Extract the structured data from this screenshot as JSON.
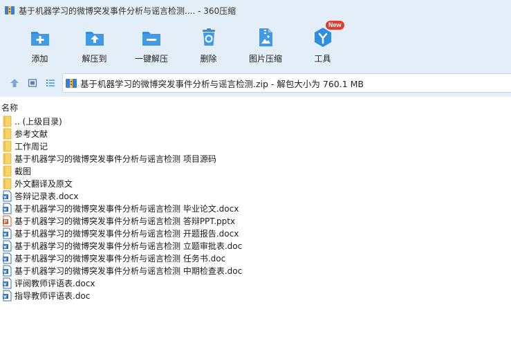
{
  "window": {
    "title": "基于机器学习的微博突发事件分析与谣言检测.... - 360压缩"
  },
  "toolbar": {
    "items": [
      {
        "label": "添加",
        "icon": "add-icon"
      },
      {
        "label": "解压到",
        "icon": "extract-to-icon"
      },
      {
        "label": "一键解压",
        "icon": "one-click-extract-icon"
      },
      {
        "label": "删除",
        "icon": "delete-icon"
      },
      {
        "label": "图片压缩",
        "icon": "image-compress-icon"
      },
      {
        "label": "工具",
        "icon": "tools-icon",
        "badge": "New"
      }
    ]
  },
  "address": {
    "path": "基于机器学习的微博突发事件分析与谣言检测.zip - 解包大小为 760.1 MB"
  },
  "list": {
    "column_name": "名称",
    "items": [
      {
        "name": ".. (上级目录)",
        "type": "folder"
      },
      {
        "name": "参考文献",
        "type": "folder"
      },
      {
        "name": "工作周记",
        "type": "folder"
      },
      {
        "name": "基于机器学习的微博突发事件分析与谣言检测 项目源码",
        "type": "folder"
      },
      {
        "name": "截图",
        "type": "folder"
      },
      {
        "name": "外文翻译及原文",
        "type": "folder"
      },
      {
        "name": "答辩记录表.docx",
        "type": "word"
      },
      {
        "name": "基于机器学习的微博突发事件分析与谣言检测 毕业论文.docx",
        "type": "word"
      },
      {
        "name": "基于机器学习的微博突发事件分析与谣言检测 答辩PPT.pptx",
        "type": "ppt"
      },
      {
        "name": "基于机器学习的微博突发事件分析与谣言检测 开题报告.docx",
        "type": "word"
      },
      {
        "name": "基于机器学习的微博突发事件分析与谣言检测 立题审批表.doc",
        "type": "word"
      },
      {
        "name": "基于机器学习的微博突发事件分析与谣言检测 任务书.doc",
        "type": "word"
      },
      {
        "name": "基于机器学习的微博突发事件分析与谣言检测 中期检查表.doc",
        "type": "word"
      },
      {
        "name": "评阅教师评语表.docx",
        "type": "word"
      },
      {
        "name": "指导教师评语表.doc",
        "type": "word"
      }
    ]
  },
  "colors": {
    "accent": "#2f8ee0",
    "chrome_bg": "#e3eef9",
    "folder": "#f7d468",
    "word": "#2b6fc4",
    "ppt": "#d9532c",
    "badge": "#e53b2f"
  }
}
